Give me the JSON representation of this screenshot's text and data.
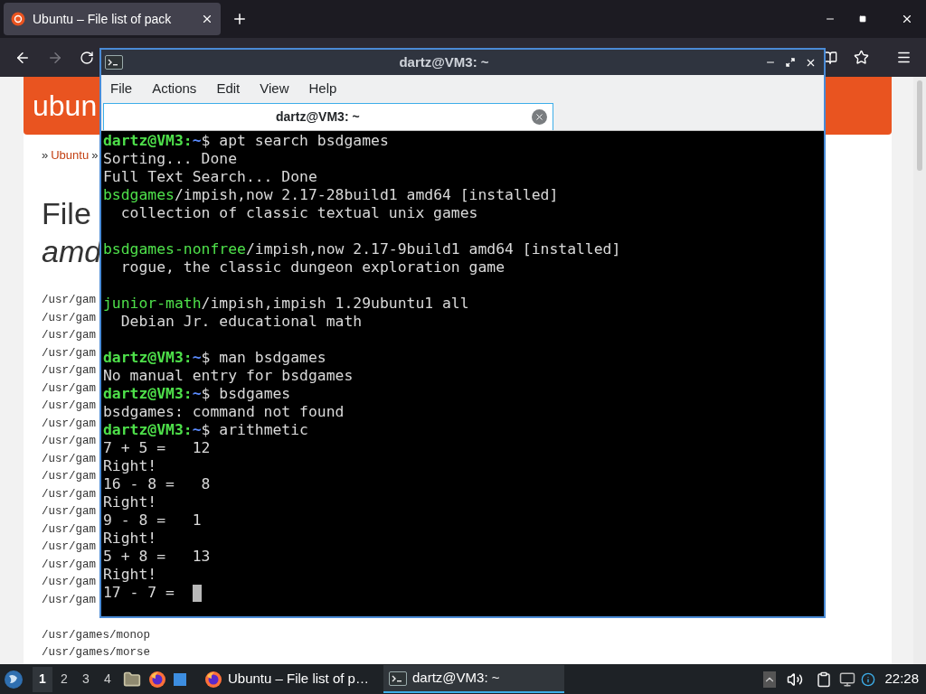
{
  "browser": {
    "tab": {
      "title": "Ubuntu – File list of pack",
      "selected": true
    },
    "page": {
      "logo": "ubun",
      "breadcrumb": [
        {
          "text": "»",
          "kind": "sep"
        },
        {
          "text": "Ubuntu",
          "kind": "link"
        },
        {
          "text": "»",
          "kind": "sep"
        }
      ],
      "title": "File",
      "subtitle": "amd",
      "files": [
        "/usr/gam",
        "/usr/gam",
        "/usr/gam",
        "/usr/gam",
        "/usr/gam",
        "/usr/gam",
        "/usr/gam",
        "/usr/gam",
        "/usr/gam",
        "/usr/gam",
        "/usr/gam",
        "/usr/gam",
        "/usr/gam",
        "/usr/gam",
        "/usr/gam",
        "/usr/gam",
        "/usr/gam",
        "/usr/gam",
        "/usr/games/monop",
        "/usr/games/morse"
      ]
    }
  },
  "terminal": {
    "title": "dartz@VM3: ~",
    "menu": [
      "File",
      "Actions",
      "Edit",
      "View",
      "Help"
    ],
    "tab": {
      "title": "dartz@VM3: ~",
      "selected": true
    },
    "lines": [
      {
        "kind": "prompt",
        "segments": [
          {
            "text": "dartz@VM3:",
            "kind": "user"
          },
          {
            "text": "~",
            "kind": "path"
          },
          {
            "text": "$ apt search bsdgames",
            "kind": "plain"
          }
        ]
      },
      {
        "kind": "output",
        "segments": [
          {
            "text": "Sorting... Done",
            "kind": "plain"
          }
        ]
      },
      {
        "kind": "output",
        "segments": [
          {
            "text": "Full Text Search... Done",
            "kind": "plain"
          }
        ]
      },
      {
        "kind": "output",
        "segments": [
          {
            "text": "bsdgames",
            "kind": "package"
          },
          {
            "text": "/impish,now 2.17-28build1 amd64 [installed]",
            "kind": "plain"
          }
        ]
      },
      {
        "kind": "output",
        "segments": [
          {
            "text": "  collection of classic textual unix games",
            "kind": "plain"
          }
        ]
      },
      {
        "kind": "blank"
      },
      {
        "kind": "output",
        "segments": [
          {
            "text": "bsdgames-nonfree",
            "kind": "package"
          },
          {
            "text": "/impish,now 2.17-9build1 amd64 [installed]",
            "kind": "plain"
          }
        ]
      },
      {
        "kind": "output",
        "segments": [
          {
            "text": "  rogue, the classic dungeon exploration game",
            "kind": "plain"
          }
        ]
      },
      {
        "kind": "blank"
      },
      {
        "kind": "output",
        "segments": [
          {
            "text": "junior-math",
            "kind": "package"
          },
          {
            "text": "/impish,impish 1.29ubuntu1 all",
            "kind": "plain"
          }
        ]
      },
      {
        "kind": "output",
        "segments": [
          {
            "text": "  Debian Jr. educational math",
            "kind": "plain"
          }
        ]
      },
      {
        "kind": "blank"
      },
      {
        "kind": "prompt",
        "segments": [
          {
            "text": "dartz@VM3:",
            "kind": "user"
          },
          {
            "text": "~",
            "kind": "path"
          },
          {
            "text": "$ man bsdgames",
            "kind": "plain"
          }
        ]
      },
      {
        "kind": "output",
        "segments": [
          {
            "text": "No manual entry for bsdgames",
            "kind": "plain"
          }
        ]
      },
      {
        "kind": "prompt",
        "segments": [
          {
            "text": "dartz@VM3:",
            "kind": "user"
          },
          {
            "text": "~",
            "kind": "path"
          },
          {
            "text": "$ bsdgames",
            "kind": "plain"
          }
        ]
      },
      {
        "kind": "output",
        "segments": [
          {
            "text": "bsdgames: command not found",
            "kind": "plain"
          }
        ]
      },
      {
        "kind": "prompt",
        "segments": [
          {
            "text": "dartz@VM3:",
            "kind": "user"
          },
          {
            "text": "~",
            "kind": "path"
          },
          {
            "text": "$ arithmetic",
            "kind": "plain"
          }
        ]
      },
      {
        "kind": "output",
        "segments": [
          {
            "text": "7 + 5 =   12",
            "kind": "plain"
          }
        ]
      },
      {
        "kind": "output",
        "segments": [
          {
            "text": "Right!",
            "kind": "plain"
          }
        ]
      },
      {
        "kind": "output",
        "segments": [
          {
            "text": "16 - 8 =   8",
            "kind": "plain"
          }
        ]
      },
      {
        "kind": "output",
        "segments": [
          {
            "text": "Right!",
            "kind": "plain"
          }
        ]
      },
      {
        "kind": "output",
        "segments": [
          {
            "text": "9 - 8 =   1",
            "kind": "plain"
          }
        ]
      },
      {
        "kind": "output",
        "segments": [
          {
            "text": "Right!",
            "kind": "plain"
          }
        ]
      },
      {
        "kind": "output",
        "segments": [
          {
            "text": "5 + 8 =   13",
            "kind": "plain"
          }
        ]
      },
      {
        "kind": "output",
        "segments": [
          {
            "text": "Right!",
            "kind": "plain"
          }
        ]
      },
      {
        "kind": "output",
        "cursor": true,
        "segments": [
          {
            "text": "17 - 7 =  ",
            "kind": "plain"
          }
        ]
      }
    ]
  },
  "taskbar": {
    "workspaces": [
      {
        "label": "1",
        "selected": true
      },
      {
        "label": "2",
        "selected": false
      },
      {
        "label": "3",
        "selected": false
      },
      {
        "label": "4",
        "selected": false
      }
    ],
    "tasks": [
      {
        "title": "Ubuntu – File list of p…",
        "kind": "browser",
        "selected": false
      },
      {
        "title": "dartz@VM3: ~",
        "kind": "terminal",
        "selected": true
      }
    ],
    "clock": "22:28"
  }
}
